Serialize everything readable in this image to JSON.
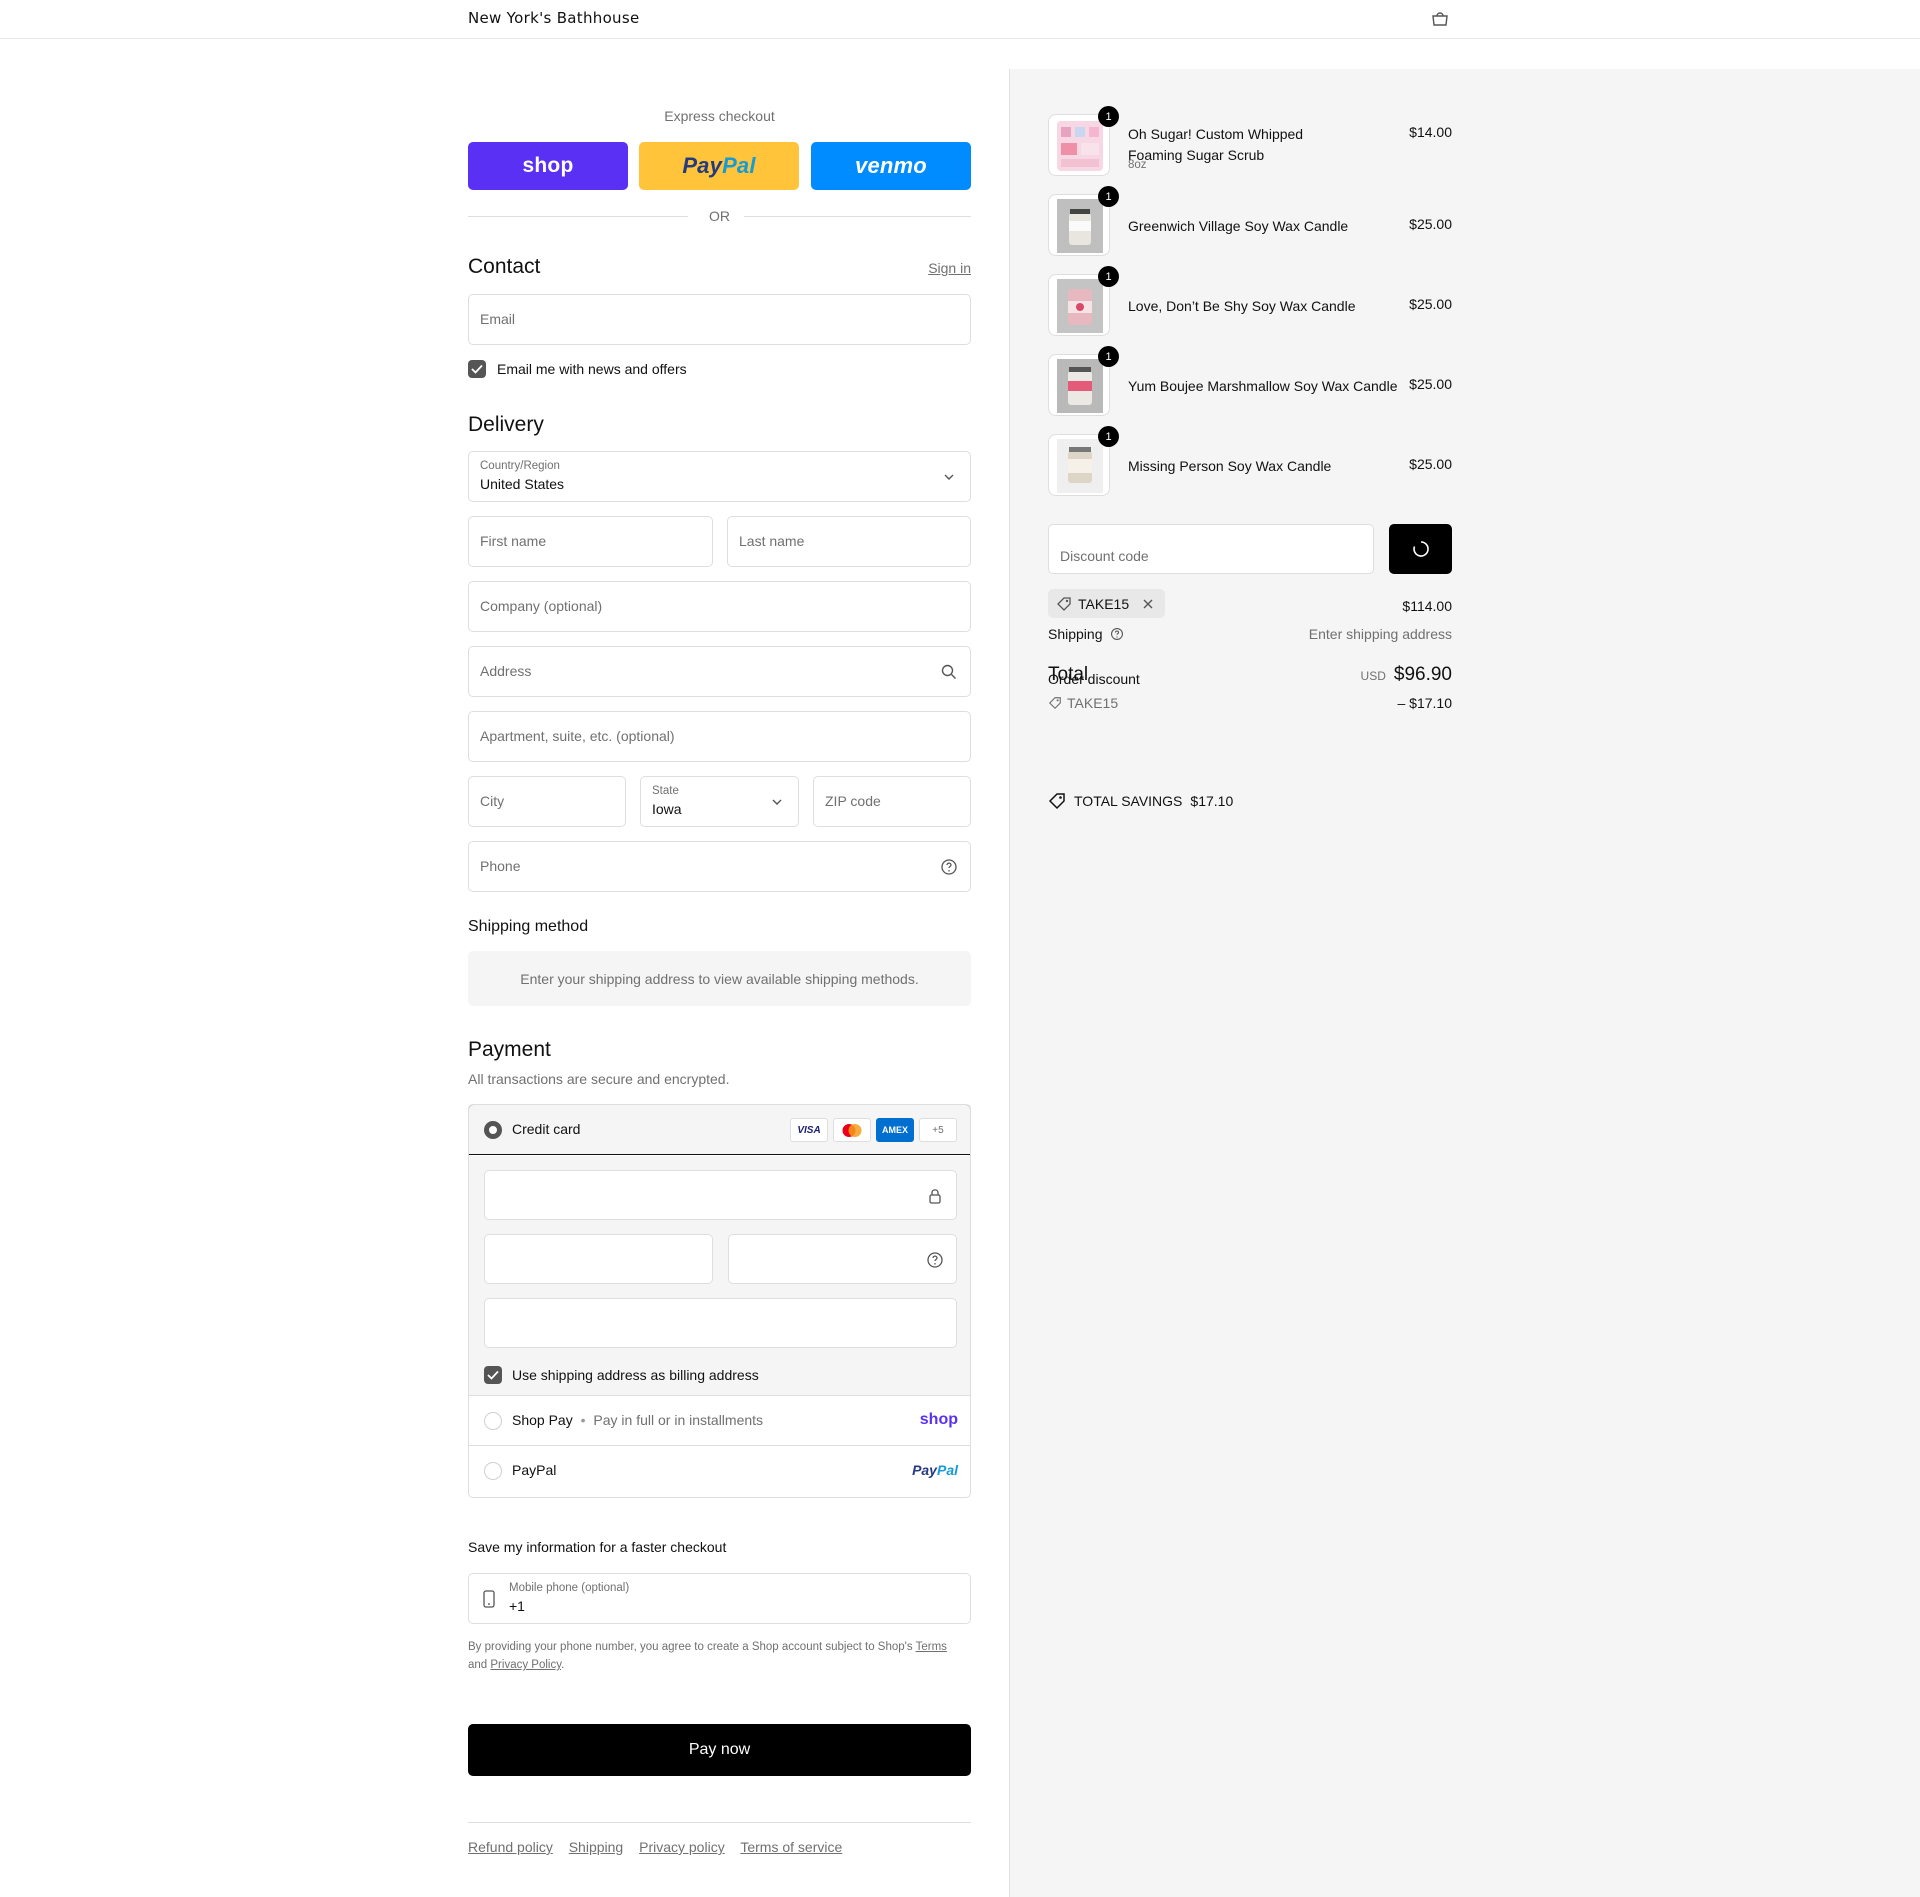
{
  "header": {
    "brand": "New York's Bathhouse",
    "cart_icon": "bag-icon"
  },
  "express": {
    "label": "Express checkout",
    "shop": "shop",
    "paypal_a": "Pay",
    "paypal_b": "Pal",
    "venmo": "venmo",
    "or": "OR"
  },
  "contact": {
    "title": "Contact",
    "sign_in": "Sign in",
    "email_placeholder": "Email",
    "newsletter_label": "Email me with news and offers"
  },
  "delivery": {
    "title": "Delivery",
    "country_label": "Country/Region",
    "country_value": "United States",
    "first_name": "First name",
    "last_name": "Last name",
    "company": "Company (optional)",
    "address": "Address",
    "apartment": "Apartment, suite, etc. (optional)",
    "city": "City",
    "state_label": "State",
    "state_value": "Iowa",
    "zip": "ZIP code",
    "phone": "Phone"
  },
  "shipping_method": {
    "title": "Shipping method",
    "notice": "Enter your shipping address to view available shipping methods."
  },
  "payment": {
    "title": "Payment",
    "subtitle": "All transactions are secure and encrypted.",
    "credit_card": "Credit card",
    "visa": "VISA",
    "amex": "AMEX",
    "more_cards": "+5",
    "billing_label": "Use shipping address as billing address",
    "shop_pay": "Shop Pay",
    "shop_pay_sub": "Pay in full or in installments",
    "shop_pay_logo": "shop",
    "paypal": "PayPal",
    "paypal_logo_a": "Pay",
    "paypal_logo_b": "Pal"
  },
  "save_info": {
    "title": "Save my information for a faster checkout",
    "mobile_label": "Mobile phone (optional)",
    "mobile_value": "+1",
    "legal_prefix": "By providing your phone number, you agree to create a Shop account subject to Shop's",
    "terms": "Terms",
    "and": "and",
    "privacy": "Privacy Policy",
    "period": "."
  },
  "pay_now": "Pay now",
  "footer": [
    "Refund policy",
    "Shipping",
    "Privacy policy",
    "Terms of service"
  ],
  "order": {
    "items": [
      {
        "name": "Oh Sugar! Custom Whipped Foaming Sugar Scrub",
        "variant": "8oz",
        "price": "$14.00",
        "qty": "1"
      },
      {
        "name": "Greenwich Village Soy Wax Candle",
        "variant": "",
        "price": "$25.00",
        "qty": "1"
      },
      {
        "name": "Love, Don’t Be Shy Soy Wax Candle",
        "variant": "",
        "price": "$25.00",
        "qty": "1"
      },
      {
        "name": "Yum Boujee Marshmallow Soy Wax Candle",
        "variant": "",
        "price": "$25.00",
        "qty": "1"
      },
      {
        "name": "Missing Person Soy Wax Candle",
        "variant": "",
        "price": "$25.00",
        "qty": "1"
      }
    ],
    "discount_placeholder": "Discount code",
    "applied_code": "TAKE15",
    "subtotal": "$114.00",
    "shipping_label": "Shipping",
    "shipping_value": "Enter shipping address",
    "total_label": "Total",
    "order_discount_label": "Order discount",
    "currency": "USD",
    "total_value": "$96.90",
    "discount_code": "TAKE15",
    "discount_value": "– $17.10",
    "savings_label": "TOTAL SAVINGS",
    "savings_value": "$17.10"
  },
  "colors": {
    "shop": "#5a31f4",
    "paypal": "#ffc439",
    "venmo": "#008cff",
    "panel": "#f5f5f5"
  }
}
